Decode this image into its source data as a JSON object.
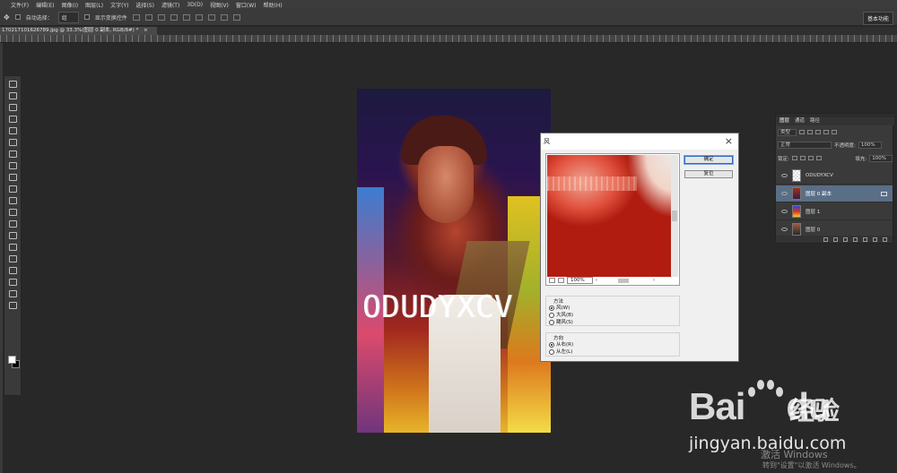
{
  "menubar": {
    "items": [
      "文件(F)",
      "编辑(E)",
      "图像(I)",
      "图层(L)",
      "文字(Y)",
      "选择(S)",
      "滤镜(T)",
      "3D(D)",
      "视图(V)",
      "窗口(W)",
      "帮助(H)"
    ]
  },
  "options": {
    "auto_select_label": "自动选择：",
    "auto_select_value": "组",
    "transform_label": "显示变换控件",
    "workspace": "基本功能"
  },
  "document_tab": {
    "title": "170217101626789.jpg @ 33.3%(图层 0 副本, RGB/8#) *",
    "close": "×"
  },
  "canvas": {
    "overlay_text": "ODUDYXCV"
  },
  "dialog": {
    "title": "风",
    "close": "×",
    "ok": "确定",
    "reset": "复位",
    "zoom": "100%",
    "method_label": "方法",
    "methods": [
      {
        "label": "风(W)",
        "selected": true
      },
      {
        "label": "大风(B)",
        "selected": false
      },
      {
        "label": "飓风(S)",
        "selected": false
      }
    ],
    "direction_label": "方向",
    "directions": [
      {
        "label": "从右(R)",
        "selected": true
      },
      {
        "label": "从左(L)",
        "selected": false
      }
    ]
  },
  "layers_panel": {
    "tabs": [
      "图层",
      "通道",
      "路径"
    ],
    "filter_kind": "类型",
    "blend_mode": "正常",
    "opacity_label": "不透明度:",
    "opacity_value": "100%",
    "lock_label": "锁定:",
    "fill_label": "填充:",
    "fill_value": "100%",
    "layers": [
      {
        "name": "ODUDYXCV",
        "selected": false
      },
      {
        "name": "图层 0 副本",
        "selected": true
      },
      {
        "name": "图层 1",
        "selected": false
      },
      {
        "name": "图层 0",
        "selected": false
      }
    ]
  },
  "watermark": {
    "brand": "Bai",
    "brand_tail": "du",
    "brand_cn": "经验",
    "url": "jingyan.baidu.com",
    "activate_title": "激活 Windows",
    "activate_hint": "转到\"设置\"以激活 Windows。"
  }
}
